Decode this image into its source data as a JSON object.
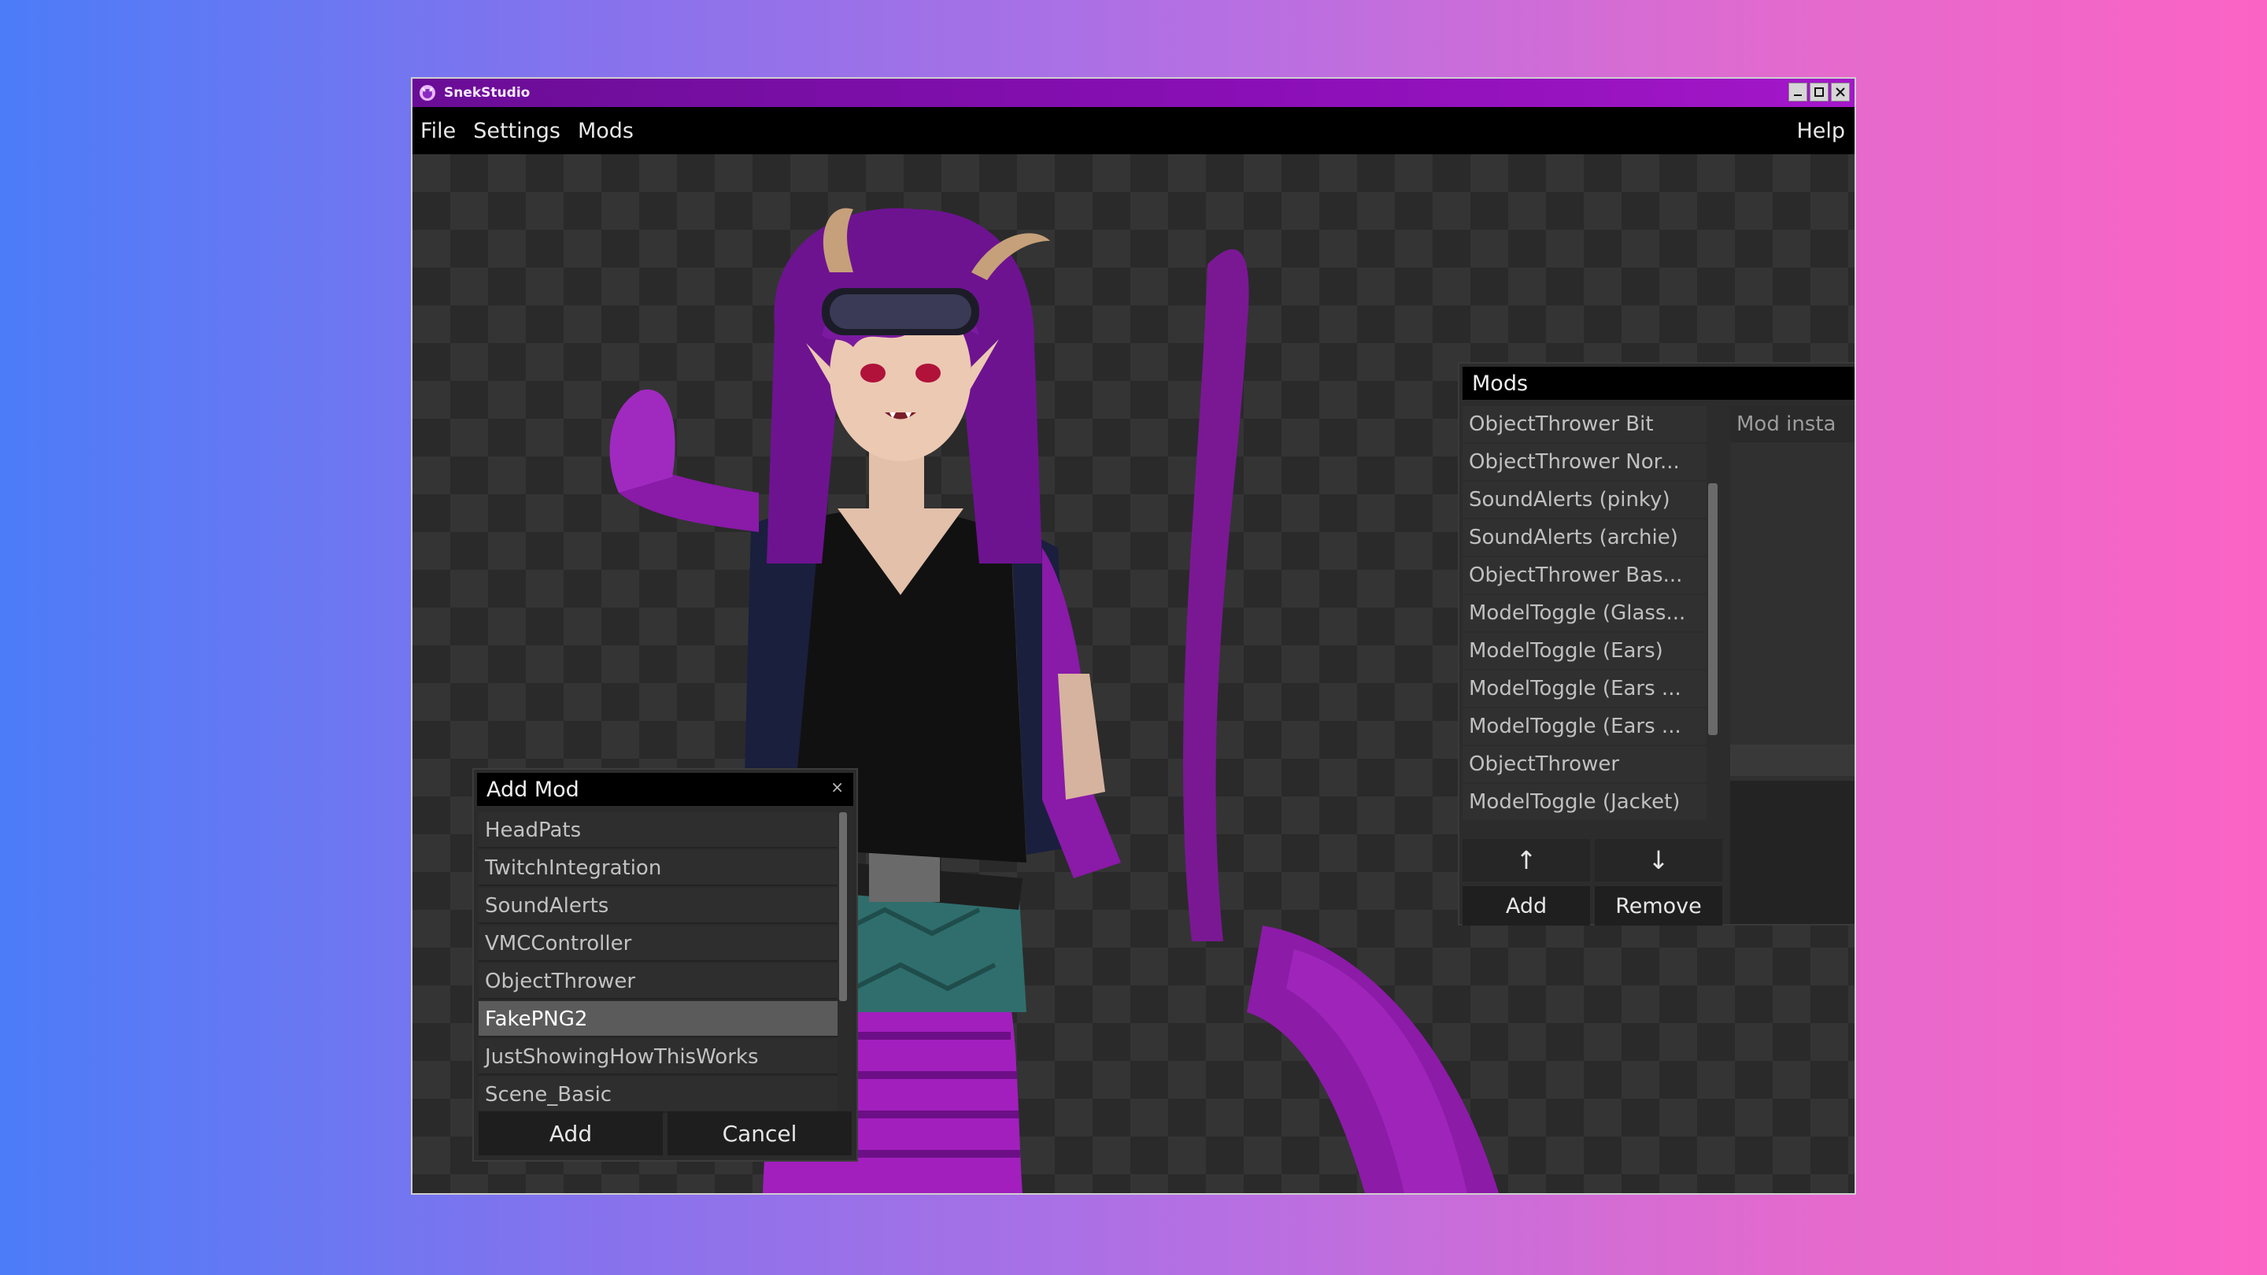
{
  "window": {
    "title": "SnekStudio"
  },
  "menu": {
    "items": [
      "File",
      "Settings",
      "Mods"
    ],
    "help": "Help"
  },
  "add_mod_dialog": {
    "title": "Add Mod",
    "close": "×",
    "items": [
      "HeadPats",
      "TwitchIntegration",
      "SoundAlerts",
      "VMCController",
      "ObjectThrower",
      "FakePNG2",
      "JustShowingHowThisWorks",
      "Scene_Basic"
    ],
    "selected": "FakePNG2",
    "add_label": "Add",
    "cancel_label": "Cancel"
  },
  "mods_panel": {
    "title": "Mods",
    "instances": [
      "ObjectThrower Bit",
      "ObjectThrower Nor...",
      "SoundAlerts (pinky)",
      "SoundAlerts (archie)",
      "ObjectThrower Bas...",
      "ModelToggle (Glass...",
      "ModelToggle (Ears)",
      "ModelToggle (Ears ...",
      "ModelToggle (Ears ...",
      "ObjectThrower",
      "ModelToggle (Jacket)"
    ],
    "up_label": "↑",
    "down_label": "↓",
    "add_label": "Add",
    "remove_label": "Remove",
    "settings_header": "Mod insta"
  },
  "colors": {
    "titlebar": "#7a0fa8",
    "accent_purple": "#9c1fc4",
    "menubar": "#000000",
    "panel": "#2c2c2c",
    "selected_item": "#5b5b5b"
  },
  "icons": {
    "app": "snek-app-icon",
    "minimize": "minimize-icon",
    "maximize": "maximize-icon",
    "close": "close-icon"
  }
}
